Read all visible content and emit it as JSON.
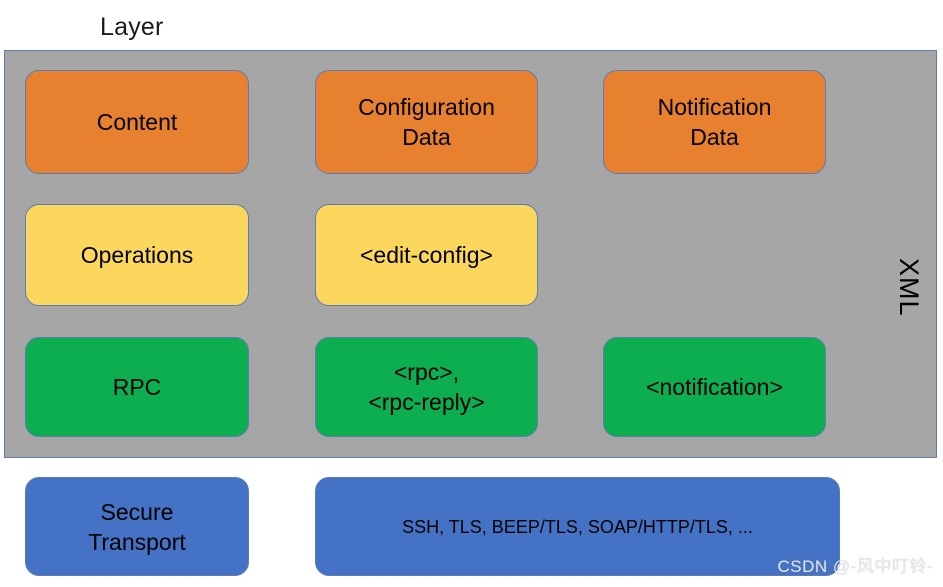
{
  "diagram": {
    "type": "layered-architecture",
    "title": "Layer",
    "side_label": "XML",
    "colors": {
      "background": "#ffffff",
      "band": "#a6a6a6",
      "band_border": "#5b7bb4",
      "content_layer": "#e8812f",
      "operations_layer": "#fcd75e",
      "rpc_layer": "#0cae4f",
      "transport_layer": "#4472c4",
      "text": "#000000"
    },
    "columns": [
      "layer-name",
      "example-request",
      "example-notification"
    ],
    "rows": [
      {
        "id": "content",
        "color_key": "content_layer",
        "cells": [
          {
            "name": "content-layer-box",
            "text": "Content"
          },
          {
            "name": "configuration-data-box",
            "text": "Configuration\nData"
          },
          {
            "name": "notification-data-box",
            "text": "Notification\nData"
          }
        ]
      },
      {
        "id": "operations",
        "color_key": "operations_layer",
        "cells": [
          {
            "name": "operations-layer-box",
            "text": "Operations"
          },
          {
            "name": "edit-config-box",
            "text": "<edit-config>"
          },
          {
            "name": "operations-empty-cell",
            "text": ""
          }
        ]
      },
      {
        "id": "rpc",
        "color_key": "rpc_layer",
        "cells": [
          {
            "name": "rpc-layer-box",
            "text": "RPC"
          },
          {
            "name": "rpc-reply-box",
            "text": "<rpc>,\n<rpc-reply>"
          },
          {
            "name": "notification-box",
            "text": "<notification>"
          }
        ]
      },
      {
        "id": "secure-transport",
        "color_key": "transport_layer",
        "cells": [
          {
            "name": "secure-transport-box",
            "text": "Secure\nTransport"
          },
          {
            "name": "transport-protocols-box",
            "text": "SSH, TLS, BEEP/TLS, SOAP/HTTP/TLS, ..."
          }
        ]
      }
    ],
    "watermark": "CSDN @-风中叮铃-"
  }
}
